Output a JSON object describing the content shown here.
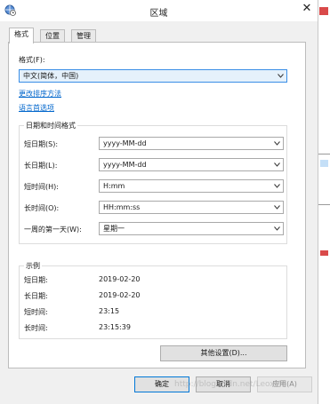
{
  "window": {
    "title": "区域",
    "close_glyph": "✕"
  },
  "tabs": [
    {
      "label": "格式",
      "active": true
    },
    {
      "label": "位置",
      "active": false
    },
    {
      "label": "管理",
      "active": false
    }
  ],
  "format": {
    "label": "格式(F):",
    "value": "中文(简体，中国)"
  },
  "links": {
    "sort_method": "更改排序方法",
    "language_prefs": "语言首选项"
  },
  "datetime": {
    "group_title": "日期和时间格式",
    "rows": [
      {
        "label": "短日期(S):",
        "value": "yyyy-MM-dd"
      },
      {
        "label": "长日期(L):",
        "value": "yyyy-MM-dd"
      },
      {
        "label": "短时间(H):",
        "value": "H:mm"
      },
      {
        "label": "长时间(O):",
        "value": "HH:mm:ss"
      },
      {
        "label": "一周的第一天(W):",
        "value": "星期一"
      }
    ]
  },
  "examples": {
    "group_title": "示例",
    "rows": [
      {
        "label": "短日期:",
        "value": "2019-02-20"
      },
      {
        "label": "长日期:",
        "value": "2019-02-20"
      },
      {
        "label": "短时间:",
        "value": "23:15"
      },
      {
        "label": "长时间:",
        "value": "23:15:39"
      }
    ]
  },
  "buttons": {
    "other_settings": "其他设置(D)...",
    "ok": "确定",
    "cancel": "取消",
    "apply": "应用(A)"
  },
  "watermark": "http://blog.csdn.net/LeoxMo",
  "colors": {
    "link": "#0066cc",
    "focus_border": "#3a8ee6",
    "focus_fill": "#e5f1fb"
  },
  "icons": {
    "app": "globe-clock-icon",
    "close": "close-icon",
    "dropdown": "chevron-down-icon"
  }
}
